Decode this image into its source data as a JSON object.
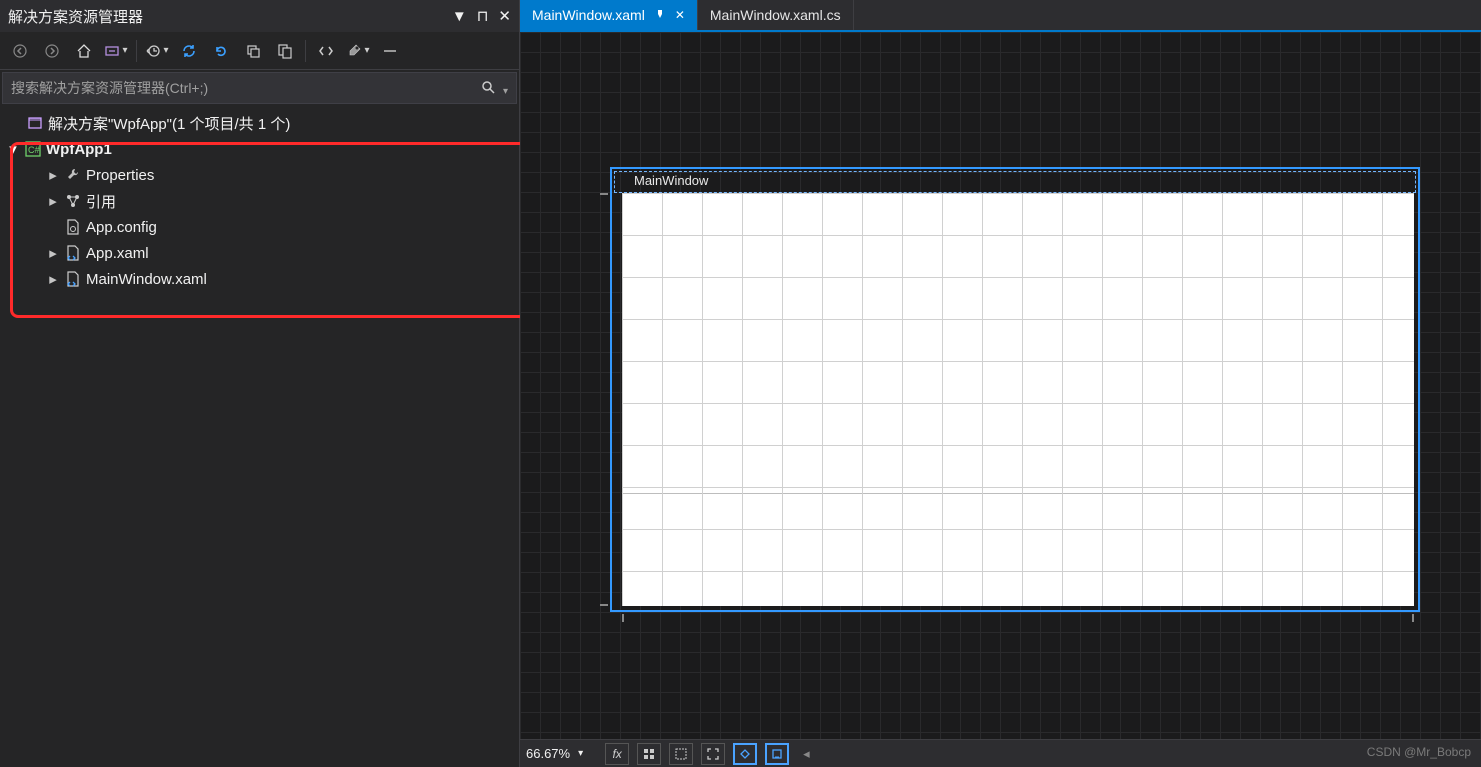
{
  "panel": {
    "title": "解决方案资源管理器",
    "search_placeholder": "搜索解决方案资源管理器(Ctrl+;)"
  },
  "tree": {
    "solution": "解决方案\"WpfApp\"(1 个项目/共 1 个)",
    "project": "WpfApp1",
    "items": {
      "properties": "Properties",
      "references": "引用",
      "appconfig": "App.config",
      "appxaml": "App.xaml",
      "mainwindow": "MainWindow.xaml"
    }
  },
  "tabs": {
    "active": "MainWindow.xaml",
    "other": "MainWindow.xaml.cs"
  },
  "designer": {
    "window_title": "MainWindow"
  },
  "status": {
    "zoom": "66.67%"
  },
  "watermark": "CSDN @Mr_Bobcp",
  "icons": {
    "dropdown": "▼",
    "pin": "⊓",
    "close": "✕",
    "back": "◁",
    "forward": "▷",
    "home": "⌂",
    "wrench": "🔧",
    "refresh": "⟳",
    "search": "🔍",
    "arrow_down": "▾",
    "arrow_right": "▸",
    "arrow_left": "◂"
  }
}
